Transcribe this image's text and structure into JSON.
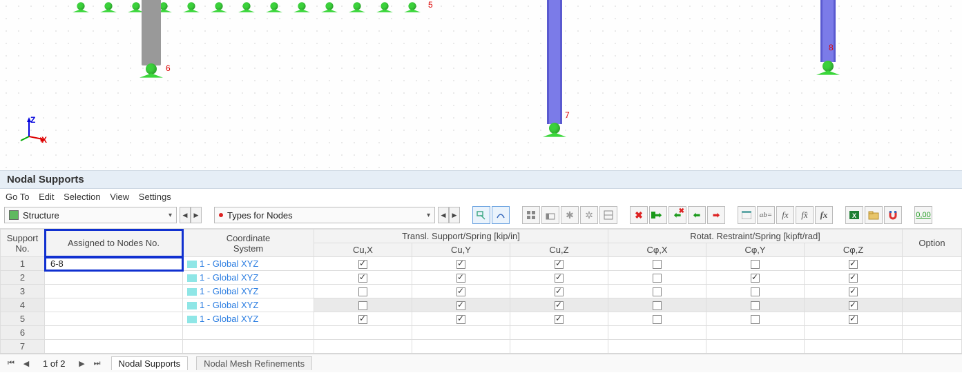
{
  "viewport": {
    "node_labels": [
      "5",
      "6",
      "7",
      "8"
    ]
  },
  "panel": {
    "title": "Nodal Supports",
    "menu": [
      "Go To",
      "Edit",
      "Selection",
      "View",
      "Settings"
    ]
  },
  "toolbar": {
    "combo_structure": "Structure",
    "combo_types": "Types for Nodes"
  },
  "table": {
    "header_groups": {
      "support_no": "Support\nNo.",
      "assigned": "Assigned to Nodes No.",
      "coord": "Coordinate\nSystem",
      "transl": "Transl. Support/Spring [kip/in]",
      "rotat": "Rotat. Restraint/Spring [kipft/rad]",
      "option": "Option"
    },
    "transl_cols": [
      "Cu,X",
      "Cu,Y",
      "Cu,Z"
    ],
    "rotat_cols": [
      "Cφ,X",
      "Cφ,Y",
      "Cφ,Z"
    ],
    "rows": [
      {
        "no": "1",
        "assigned": "6-8",
        "coord": "1 - Global XYZ",
        "t": [
          true,
          true,
          true
        ],
        "r": [
          false,
          false,
          true
        ]
      },
      {
        "no": "2",
        "assigned": "",
        "coord": "1 - Global XYZ",
        "t": [
          true,
          true,
          true
        ],
        "r": [
          false,
          true,
          true
        ]
      },
      {
        "no": "3",
        "assigned": "",
        "coord": "1 - Global XYZ",
        "t": [
          false,
          true,
          true
        ],
        "r": [
          false,
          false,
          true
        ]
      },
      {
        "no": "4",
        "assigned": "",
        "coord": "1 - Global XYZ",
        "t": [
          false,
          true,
          true
        ],
        "r": [
          false,
          false,
          true
        ]
      },
      {
        "no": "5",
        "assigned": "",
        "coord": "1 - Global XYZ",
        "t": [
          true,
          true,
          true
        ],
        "r": [
          false,
          false,
          true
        ]
      },
      {
        "no": "6",
        "assigned": "",
        "coord": "",
        "t": null,
        "r": null
      },
      {
        "no": "7",
        "assigned": "",
        "coord": "",
        "t": null,
        "r": null
      }
    ]
  },
  "footer": {
    "page_text": "1 of 2",
    "tabs": [
      "Nodal Supports",
      "Nodal Mesh Refinements"
    ]
  }
}
